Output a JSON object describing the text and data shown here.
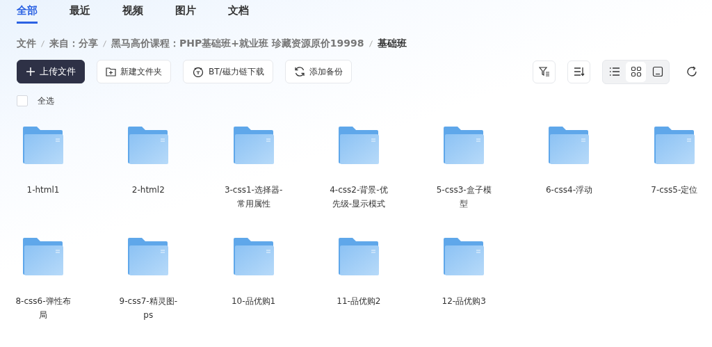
{
  "tabs": [
    {
      "label": "全部",
      "selected": true
    },
    {
      "label": "最近",
      "selected": false
    },
    {
      "label": "视频",
      "selected": false
    },
    {
      "label": "图片",
      "selected": false
    },
    {
      "label": "文档",
      "selected": false
    }
  ],
  "breadcrumb": [
    "文件",
    "来自：分享",
    "黑马高价课程：PHP基础班+就业班 珍藏资源原价19998",
    "基础班"
  ],
  "toolbar": {
    "buttons": [
      {
        "kind": "upload",
        "label": "上传文件"
      },
      {
        "kind": "new-folder",
        "label": "新建文件夹"
      },
      {
        "kind": "bt",
        "label": "BT/磁力链下载"
      },
      {
        "kind": "backup",
        "label": "添加备份"
      }
    ],
    "view_modes": [
      {
        "kind": "list",
        "selected": false
      },
      {
        "kind": "grid",
        "selected": true
      },
      {
        "kind": "preview",
        "selected": false
      }
    ]
  },
  "select_all": {
    "label": "全选",
    "checked": false
  },
  "folders": [
    {
      "name": "1-html1"
    },
    {
      "name": "2-html2"
    },
    {
      "name": "3-css1-选择器-常用属性"
    },
    {
      "name": "4-css2-背景-优先级-显示模式"
    },
    {
      "name": "5-css3-盒子模型"
    },
    {
      "name": "6-css4-浮动"
    },
    {
      "name": "7-css5-定位"
    },
    {
      "name": "8-css6-弹性布局"
    },
    {
      "name": "9-css7-精灵图-ps"
    },
    {
      "name": "10-品优购1"
    },
    {
      "name": "11-品优购2"
    },
    {
      "name": "12-品优购3"
    }
  ]
}
